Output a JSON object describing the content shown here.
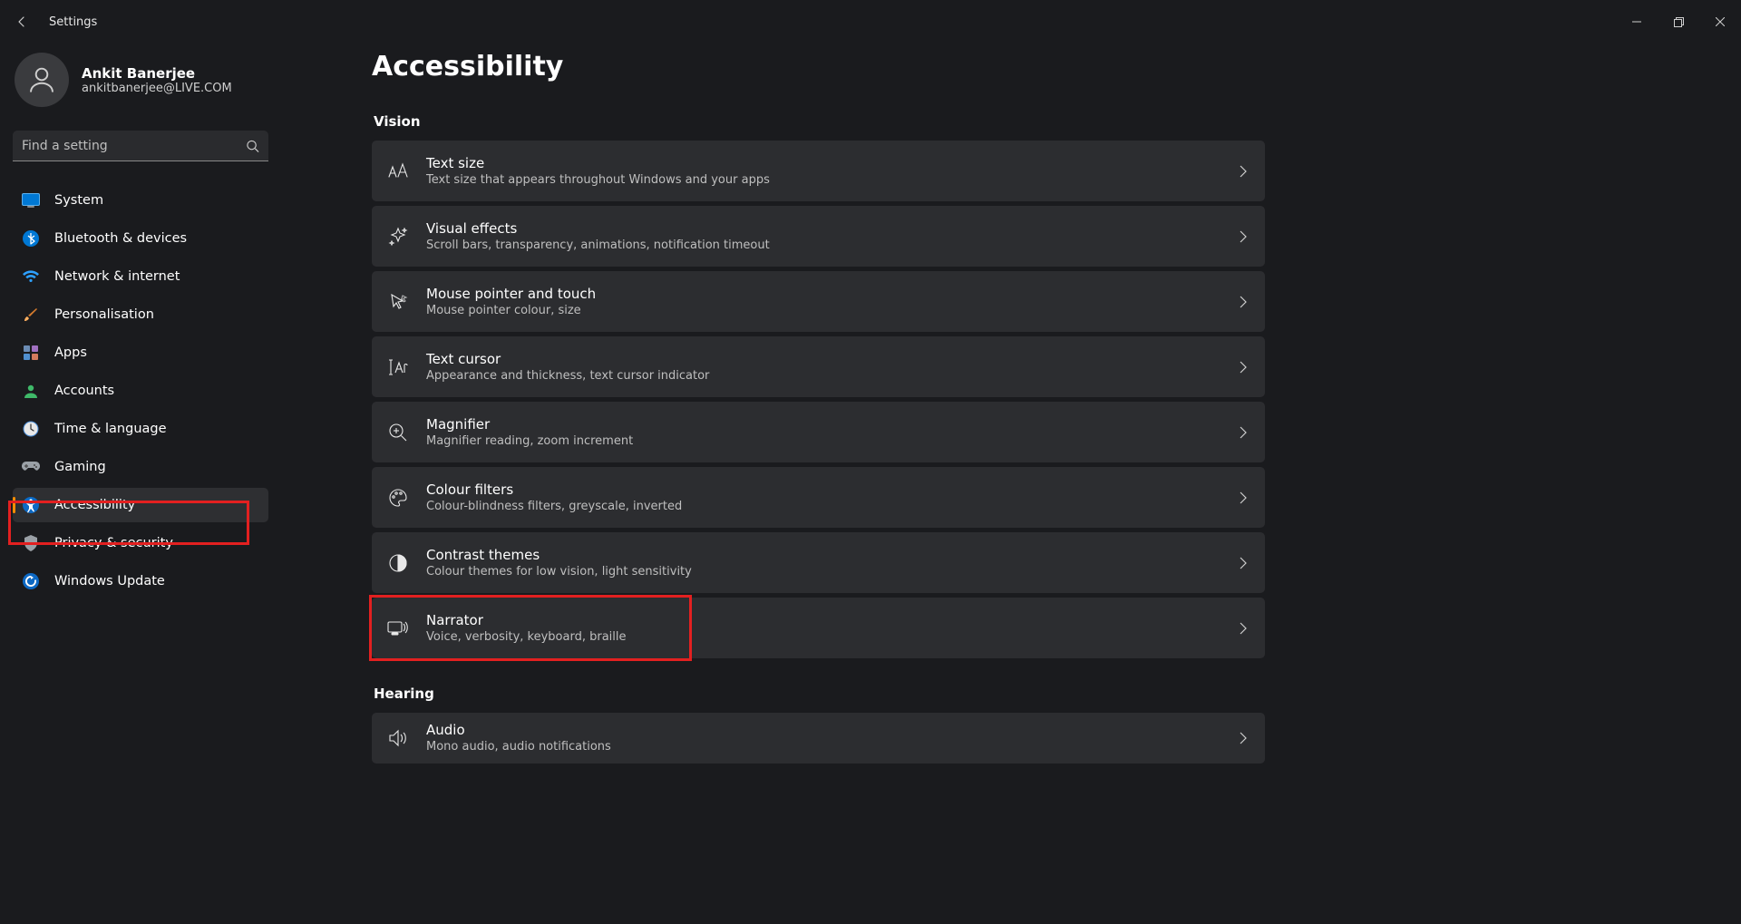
{
  "window": {
    "title": "Settings"
  },
  "user": {
    "name": "Ankit Banerjee",
    "email": "ankitbanerjee@LIVE.COM"
  },
  "search": {
    "placeholder": "Find a setting"
  },
  "nav": {
    "items": [
      {
        "id": "system",
        "label": "System"
      },
      {
        "id": "bluetooth",
        "label": "Bluetooth & devices"
      },
      {
        "id": "network",
        "label": "Network & internet"
      },
      {
        "id": "personalisation",
        "label": "Personalisation"
      },
      {
        "id": "apps",
        "label": "Apps"
      },
      {
        "id": "accounts",
        "label": "Accounts"
      },
      {
        "id": "time",
        "label": "Time & language"
      },
      {
        "id": "gaming",
        "label": "Gaming"
      },
      {
        "id": "accessibility",
        "label": "Accessibility"
      },
      {
        "id": "privacy",
        "label": "Privacy & security"
      },
      {
        "id": "update",
        "label": "Windows Update"
      }
    ],
    "active_id": "accessibility"
  },
  "page": {
    "title": "Accessibility",
    "sections": [
      {
        "heading": "Vision",
        "items": [
          {
            "id": "text-size",
            "title": "Text size",
            "subtitle": "Text size that appears throughout Windows and your apps"
          },
          {
            "id": "visual-effects",
            "title": "Visual effects",
            "subtitle": "Scroll bars, transparency, animations, notification timeout"
          },
          {
            "id": "mouse-pointer",
            "title": "Mouse pointer and touch",
            "subtitle": "Mouse pointer colour, size"
          },
          {
            "id": "text-cursor",
            "title": "Text cursor",
            "subtitle": "Appearance and thickness, text cursor indicator"
          },
          {
            "id": "magnifier",
            "title": "Magnifier",
            "subtitle": "Magnifier reading, zoom increment"
          },
          {
            "id": "colour-filters",
            "title": "Colour filters",
            "subtitle": "Colour-blindness filters, greyscale, inverted"
          },
          {
            "id": "contrast-themes",
            "title": "Contrast themes",
            "subtitle": "Colour themes for low vision, light sensitivity"
          },
          {
            "id": "narrator",
            "title": "Narrator",
            "subtitle": "Voice, verbosity, keyboard, braille"
          }
        ]
      },
      {
        "heading": "Hearing",
        "items": [
          {
            "id": "audio",
            "title": "Audio",
            "subtitle": "Mono audio, audio notifications"
          }
        ]
      }
    ]
  },
  "highlights": {
    "sidebar_item_id": "accessibility",
    "content_item_id": "narrator"
  }
}
